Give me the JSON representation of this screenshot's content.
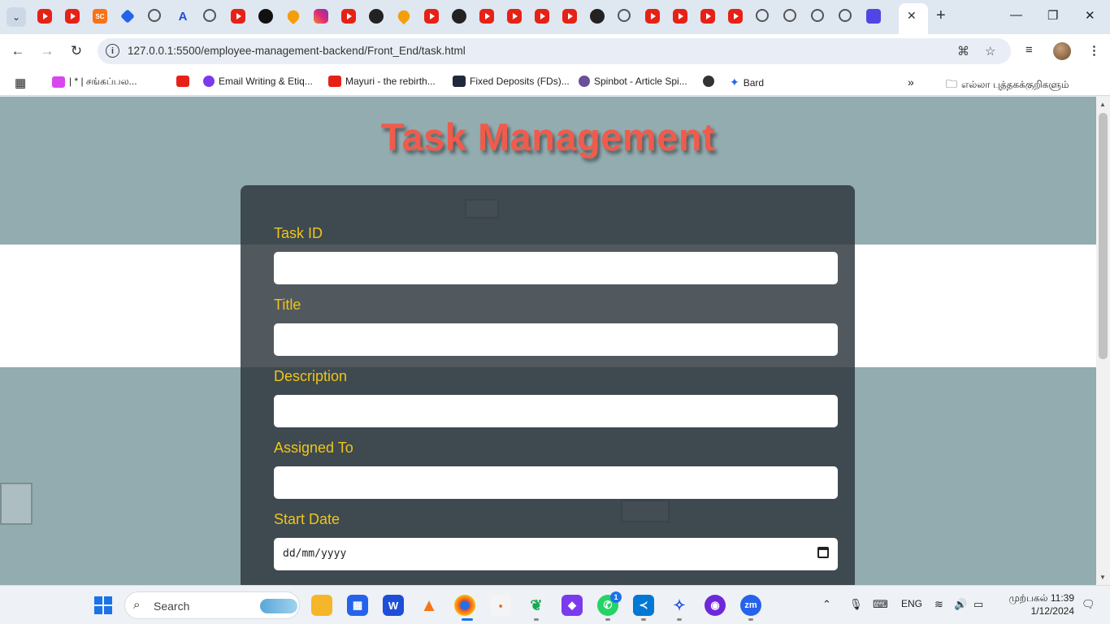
{
  "browser": {
    "url": "127.0.0.1:5500/employee-management-backend/Front_End/task.html",
    "tab_favicons": [
      "yt",
      "yt",
      "sc",
      "blue",
      "globe",
      "az",
      "globe",
      "yt",
      "grn",
      "orange",
      "ig",
      "yt",
      "gh",
      "orange",
      "yt",
      "gh",
      "yt",
      "yt",
      "yt",
      "yt",
      "gh",
      "globe",
      "yt",
      "yt",
      "yt",
      "yt",
      "globe",
      "globe",
      "globe",
      "globe",
      "list"
    ],
    "bookmarks": [
      {
        "label": "| * | சங்கப்பல...",
        "icon_color": "#d946ef"
      },
      {
        "label": "",
        "icon_color": "#e62117"
      },
      {
        "label": "Email Writing & Etiq...",
        "icon_color": "#7c3aed"
      },
      {
        "label": "Mayuri - the rebirth...",
        "icon_color": "#e62117"
      },
      {
        "label": "Fixed Deposits (FDs)...",
        "icon_color": "#1e293b"
      },
      {
        "label": "Spinbot - Article Spi...",
        "icon_color": "#6b4f99"
      },
      {
        "label": "",
        "icon_color": "#333333"
      },
      {
        "label": "Bard",
        "icon_color": "#2563eb"
      }
    ],
    "bookmarks_folder": "எல்லா புத்தகக்குறிகளும்"
  },
  "page": {
    "title": "Task Management",
    "fields": [
      {
        "label": "Task ID",
        "value": ""
      },
      {
        "label": "Title",
        "value": ""
      },
      {
        "label": "Description",
        "value": ""
      },
      {
        "label": "Assigned To",
        "value": ""
      },
      {
        "label": "Start Date",
        "value": "dd/mm/yyyy"
      }
    ],
    "title_color": "#f05b4b",
    "label_color": "#f0c419"
  },
  "taskbar": {
    "search_placeholder": "Search",
    "language": "ENG",
    "time": "முற்பகல் 11:39",
    "date": "1/12/2024",
    "whatsapp_badge": "1"
  }
}
